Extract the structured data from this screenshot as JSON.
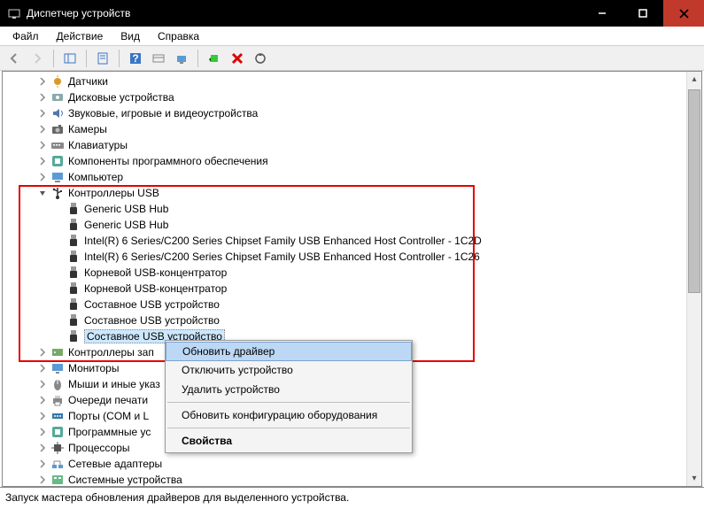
{
  "window": {
    "title": "Диспетчер устройств"
  },
  "menu": {
    "file": "Файл",
    "action": "Действие",
    "view": "Вид",
    "help": "Справка"
  },
  "tree": {
    "items": [
      {
        "depth": 1,
        "exp": "collapsed",
        "icon": "sensor",
        "label": "Датчики"
      },
      {
        "depth": 1,
        "exp": "collapsed",
        "icon": "disk",
        "label": "Дисковые устройства"
      },
      {
        "depth": 1,
        "exp": "collapsed",
        "icon": "audio",
        "label": "Звуковые, игровые и видеоустройства"
      },
      {
        "depth": 1,
        "exp": "collapsed",
        "icon": "camera",
        "label": "Камеры"
      },
      {
        "depth": 1,
        "exp": "collapsed",
        "icon": "keyboard",
        "label": "Клавиатуры"
      },
      {
        "depth": 1,
        "exp": "collapsed",
        "icon": "software",
        "label": "Компоненты программного обеспечения"
      },
      {
        "depth": 1,
        "exp": "collapsed",
        "icon": "computer",
        "label": "Компьютер"
      },
      {
        "depth": 1,
        "exp": "expanded",
        "icon": "usb",
        "label": "Контроллеры USB"
      },
      {
        "depth": 2,
        "exp": "none",
        "icon": "usbdev",
        "label": "Generic USB Hub"
      },
      {
        "depth": 2,
        "exp": "none",
        "icon": "usbdev",
        "label": "Generic USB Hub"
      },
      {
        "depth": 2,
        "exp": "none",
        "icon": "usbdev",
        "label": "Intel(R) 6 Series/C200 Series Chipset Family USB Enhanced Host Controller - 1C2D"
      },
      {
        "depth": 2,
        "exp": "none",
        "icon": "usbdev",
        "label": "Intel(R) 6 Series/C200 Series Chipset Family USB Enhanced Host Controller - 1C26"
      },
      {
        "depth": 2,
        "exp": "none",
        "icon": "usbdev",
        "label": "Корневой USB-концентратор"
      },
      {
        "depth": 2,
        "exp": "none",
        "icon": "usbdev",
        "label": "Корневой USB-концентратор"
      },
      {
        "depth": 2,
        "exp": "none",
        "icon": "usbdev",
        "label": "Составное USB устройство"
      },
      {
        "depth": 2,
        "exp": "none",
        "icon": "usbdev",
        "label": "Составное USB устройство"
      },
      {
        "depth": 2,
        "exp": "none",
        "icon": "usbdev",
        "label": "Составное USB устройство",
        "selected": true
      },
      {
        "depth": 1,
        "exp": "collapsed",
        "icon": "storage",
        "label": "Контроллеры зап"
      },
      {
        "depth": 1,
        "exp": "collapsed",
        "icon": "monitor",
        "label": "Мониторы"
      },
      {
        "depth": 1,
        "exp": "collapsed",
        "icon": "mouse",
        "label": "Мыши и иные указ"
      },
      {
        "depth": 1,
        "exp": "collapsed",
        "icon": "printer",
        "label": "Очереди печати"
      },
      {
        "depth": 1,
        "exp": "collapsed",
        "icon": "port",
        "label": "Порты (COM и L"
      },
      {
        "depth": 1,
        "exp": "collapsed",
        "icon": "software",
        "label": "Программные ус"
      },
      {
        "depth": 1,
        "exp": "collapsed",
        "icon": "cpu",
        "label": "Процессоры"
      },
      {
        "depth": 1,
        "exp": "collapsed",
        "icon": "network",
        "label": "Сетевые адаптеры"
      },
      {
        "depth": 1,
        "exp": "collapsed",
        "icon": "system",
        "label": "Системные устройства"
      }
    ]
  },
  "context_menu": {
    "update_driver": "Обновить драйвер",
    "disable": "Отключить устройство",
    "uninstall": "Удалить устройство",
    "scan": "Обновить конфигурацию оборудования",
    "properties": "Свойства"
  },
  "status": {
    "text": "Запуск мастера обновления драйверов для выделенного устройства."
  },
  "colors": {
    "highlight_border": "#e60000",
    "menu_highlight": "#bcd8f5"
  }
}
